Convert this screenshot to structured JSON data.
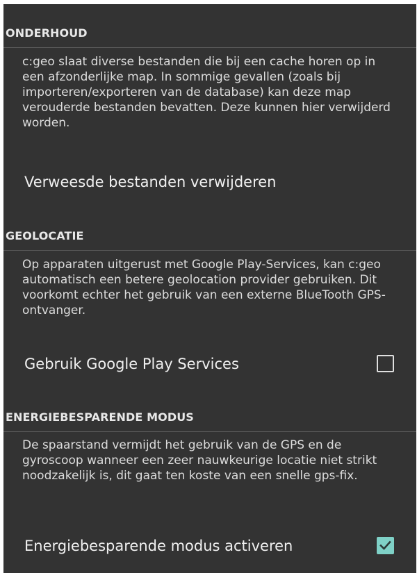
{
  "sections": [
    {
      "header": "ONDERHOUD",
      "summary": "c:geo slaat diverse bestanden die bij een cache horen op in een afzonderlijke map. In sommige gevallen (zoals bij importeren/exporteren van de database) kan deze map verouderde bestanden bevatten. Deze kunnen hier verwijderd worden.",
      "pref_title": "Verweesde bestanden verwijderen"
    },
    {
      "header": "GEOLOCATIE",
      "summary": "Op apparaten uitgerust met Google Play-Services, kan c:geo automatisch een betere geolocation provider gebruiken. Dit voorkomt echter het gebruik van een externe BlueTooth GPS-ontvanger.",
      "pref_title": "Gebruik Google Play Services",
      "checked": false
    },
    {
      "header": "ENERGIEBESPARENDE MODUS",
      "summary": "De spaarstand vermijdt het gebruik van de GPS en de gyroscoop wanneer een zeer nauwkeurige locatie niet strikt noodzakelijk is, dit gaat ten koste van een snelle gps-fix.",
      "pref_title": "Energiebesparende modus activeren",
      "checked": true
    }
  ],
  "colors": {
    "background": "#333333",
    "accent": "#7fd1c7",
    "divider": "#5a5a5a"
  },
  "icons": {
    "unchecked": "checkbox-unchecked-icon",
    "checked": "checkbox-checked-icon"
  }
}
